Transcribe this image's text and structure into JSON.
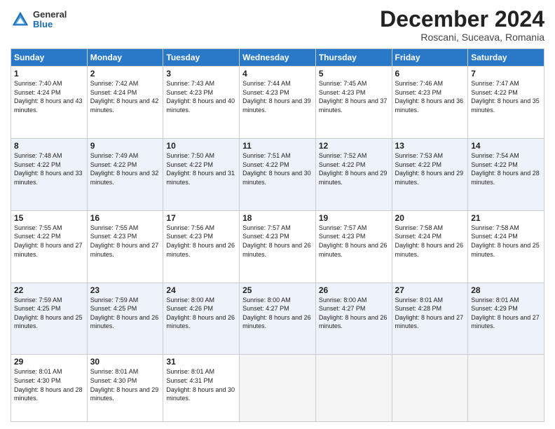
{
  "header": {
    "logo_general": "General",
    "logo_blue": "Blue",
    "month_title": "December 2024",
    "location": "Roscani, Suceava, Romania"
  },
  "days_of_week": [
    "Sunday",
    "Monday",
    "Tuesday",
    "Wednesday",
    "Thursday",
    "Friday",
    "Saturday"
  ],
  "weeks": [
    [
      {
        "day": "1",
        "sunrise": "Sunrise: 7:40 AM",
        "sunset": "Sunset: 4:24 PM",
        "daylight": "Daylight: 8 hours and 43 minutes."
      },
      {
        "day": "2",
        "sunrise": "Sunrise: 7:42 AM",
        "sunset": "Sunset: 4:24 PM",
        "daylight": "Daylight: 8 hours and 42 minutes."
      },
      {
        "day": "3",
        "sunrise": "Sunrise: 7:43 AM",
        "sunset": "Sunset: 4:23 PM",
        "daylight": "Daylight: 8 hours and 40 minutes."
      },
      {
        "day": "4",
        "sunrise": "Sunrise: 7:44 AM",
        "sunset": "Sunset: 4:23 PM",
        "daylight": "Daylight: 8 hours and 39 minutes."
      },
      {
        "day": "5",
        "sunrise": "Sunrise: 7:45 AM",
        "sunset": "Sunset: 4:23 PM",
        "daylight": "Daylight: 8 hours and 37 minutes."
      },
      {
        "day": "6",
        "sunrise": "Sunrise: 7:46 AM",
        "sunset": "Sunset: 4:23 PM",
        "daylight": "Daylight: 8 hours and 36 minutes."
      },
      {
        "day": "7",
        "sunrise": "Sunrise: 7:47 AM",
        "sunset": "Sunset: 4:22 PM",
        "daylight": "Daylight: 8 hours and 35 minutes."
      }
    ],
    [
      {
        "day": "8",
        "sunrise": "Sunrise: 7:48 AM",
        "sunset": "Sunset: 4:22 PM",
        "daylight": "Daylight: 8 hours and 33 minutes."
      },
      {
        "day": "9",
        "sunrise": "Sunrise: 7:49 AM",
        "sunset": "Sunset: 4:22 PM",
        "daylight": "Daylight: 8 hours and 32 minutes."
      },
      {
        "day": "10",
        "sunrise": "Sunrise: 7:50 AM",
        "sunset": "Sunset: 4:22 PM",
        "daylight": "Daylight: 8 hours and 31 minutes."
      },
      {
        "day": "11",
        "sunrise": "Sunrise: 7:51 AM",
        "sunset": "Sunset: 4:22 PM",
        "daylight": "Daylight: 8 hours and 30 minutes."
      },
      {
        "day": "12",
        "sunrise": "Sunrise: 7:52 AM",
        "sunset": "Sunset: 4:22 PM",
        "daylight": "Daylight: 8 hours and 29 minutes."
      },
      {
        "day": "13",
        "sunrise": "Sunrise: 7:53 AM",
        "sunset": "Sunset: 4:22 PM",
        "daylight": "Daylight: 8 hours and 29 minutes."
      },
      {
        "day": "14",
        "sunrise": "Sunrise: 7:54 AM",
        "sunset": "Sunset: 4:22 PM",
        "daylight": "Daylight: 8 hours and 28 minutes."
      }
    ],
    [
      {
        "day": "15",
        "sunrise": "Sunrise: 7:55 AM",
        "sunset": "Sunset: 4:22 PM",
        "daylight": "Daylight: 8 hours and 27 minutes."
      },
      {
        "day": "16",
        "sunrise": "Sunrise: 7:55 AM",
        "sunset": "Sunset: 4:23 PM",
        "daylight": "Daylight: 8 hours and 27 minutes."
      },
      {
        "day": "17",
        "sunrise": "Sunrise: 7:56 AM",
        "sunset": "Sunset: 4:23 PM",
        "daylight": "Daylight: 8 hours and 26 minutes."
      },
      {
        "day": "18",
        "sunrise": "Sunrise: 7:57 AM",
        "sunset": "Sunset: 4:23 PM",
        "daylight": "Daylight: 8 hours and 26 minutes."
      },
      {
        "day": "19",
        "sunrise": "Sunrise: 7:57 AM",
        "sunset": "Sunset: 4:23 PM",
        "daylight": "Daylight: 8 hours and 26 minutes."
      },
      {
        "day": "20",
        "sunrise": "Sunrise: 7:58 AM",
        "sunset": "Sunset: 4:24 PM",
        "daylight": "Daylight: 8 hours and 26 minutes."
      },
      {
        "day": "21",
        "sunrise": "Sunrise: 7:58 AM",
        "sunset": "Sunset: 4:24 PM",
        "daylight": "Daylight: 8 hours and 25 minutes."
      }
    ],
    [
      {
        "day": "22",
        "sunrise": "Sunrise: 7:59 AM",
        "sunset": "Sunset: 4:25 PM",
        "daylight": "Daylight: 8 hours and 25 minutes."
      },
      {
        "day": "23",
        "sunrise": "Sunrise: 7:59 AM",
        "sunset": "Sunset: 4:25 PM",
        "daylight": "Daylight: 8 hours and 26 minutes."
      },
      {
        "day": "24",
        "sunrise": "Sunrise: 8:00 AM",
        "sunset": "Sunset: 4:26 PM",
        "daylight": "Daylight: 8 hours and 26 minutes."
      },
      {
        "day": "25",
        "sunrise": "Sunrise: 8:00 AM",
        "sunset": "Sunset: 4:27 PM",
        "daylight": "Daylight: 8 hours and 26 minutes."
      },
      {
        "day": "26",
        "sunrise": "Sunrise: 8:00 AM",
        "sunset": "Sunset: 4:27 PM",
        "daylight": "Daylight: 8 hours and 26 minutes."
      },
      {
        "day": "27",
        "sunrise": "Sunrise: 8:01 AM",
        "sunset": "Sunset: 4:28 PM",
        "daylight": "Daylight: 8 hours and 27 minutes."
      },
      {
        "day": "28",
        "sunrise": "Sunrise: 8:01 AM",
        "sunset": "Sunset: 4:29 PM",
        "daylight": "Daylight: 8 hours and 27 minutes."
      }
    ],
    [
      {
        "day": "29",
        "sunrise": "Sunrise: 8:01 AM",
        "sunset": "Sunset: 4:30 PM",
        "daylight": "Daylight: 8 hours and 28 minutes."
      },
      {
        "day": "30",
        "sunrise": "Sunrise: 8:01 AM",
        "sunset": "Sunset: 4:30 PM",
        "daylight": "Daylight: 8 hours and 29 minutes."
      },
      {
        "day": "31",
        "sunrise": "Sunrise: 8:01 AM",
        "sunset": "Sunset: 4:31 PM",
        "daylight": "Daylight: 8 hours and 30 minutes."
      },
      null,
      null,
      null,
      null
    ]
  ]
}
